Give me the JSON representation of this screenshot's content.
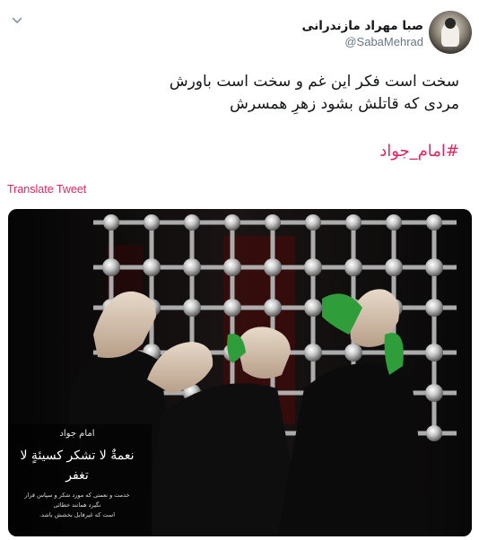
{
  "user": {
    "display_name": "صبا مهراد مازندرانی",
    "handle": "@SabaMehrad"
  },
  "tweet": {
    "lines": [
      "سخت است فکر این غم و سخت است باورش",
      "مردی که قاتلش بشود زهرِ همسرش"
    ],
    "hashtag": "#امام_جواد",
    "translate_label": "Translate Tweet"
  },
  "media": {
    "caption_small": "امام جواد",
    "caption_big": "نعمةٌ لا تشكر كسيئةٍ لا تغفر",
    "caption_body_1": "خدمت و نعمتی که مورد شکر و سپاس قرار نگیرد همانند خطائی",
    "caption_body_2": "است که غیرقابل بخشش باشد."
  },
  "icons": {
    "chevron": "chevron-down-icon",
    "avatar": "avatar"
  },
  "colors": {
    "accent": "#e0245e",
    "text": "#14171a",
    "secondary": "#657786"
  }
}
